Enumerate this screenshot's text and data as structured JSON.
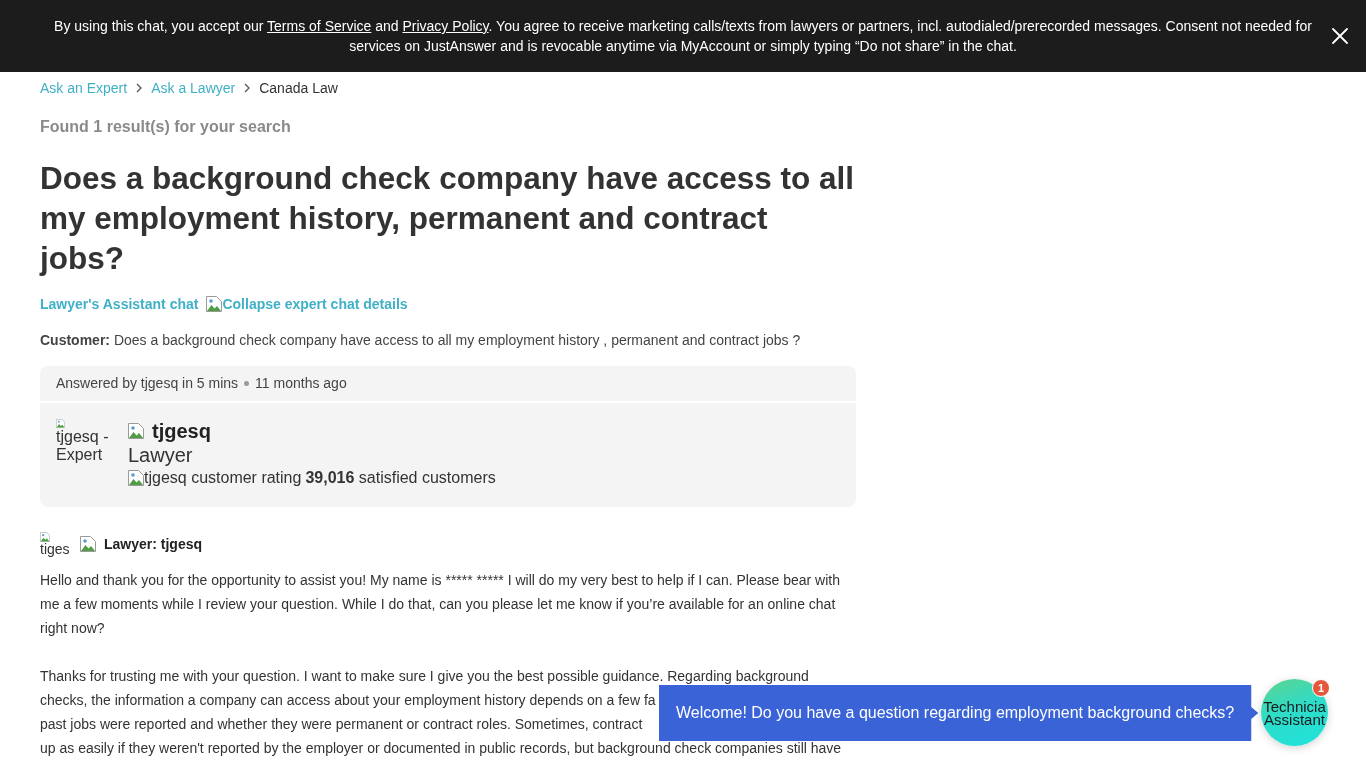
{
  "consent_banner": {
    "segments": [
      {
        "kind": "text",
        "text": "By using this chat, you accept our "
      },
      {
        "kind": "link",
        "text": "Terms of Service"
      },
      {
        "kind": "text",
        "text": " and "
      },
      {
        "kind": "link",
        "text": "Privacy Policy"
      },
      {
        "kind": "text",
        "text": ". You agree to receive marketing calls/texts from lawyers or partners, incl. autodialed/prerecorded messages. Consent not needed for services on JustAnswer and is revocable anytime via MyAccount or simply typing “Do not share” in the chat."
      }
    ]
  },
  "breadcrumb": [
    {
      "kind": "link",
      "text": "Ask an Expert"
    },
    {
      "kind": "link",
      "text": "Ask a Lawyer"
    },
    {
      "kind": "current",
      "text": "Canada Law"
    }
  ],
  "search_summary": "Found 1 result(s) for your search",
  "question_title": "Does a background check company have access to all my employment history, permanent and contract jobs?",
  "chat_links": [
    {
      "kind": "text_link",
      "text": "Lawyer's Assistant chat"
    },
    {
      "kind": "image_link",
      "text": "Collapse expert chat details"
    }
  ],
  "customer_question": "**Customer:** Does a background check company have access to all my employment history , permanent and contract jobs ?",
  "answer_card": {
    "answered_by": "Answered by tjgesq in 5 mins",
    "time_ago": "11 months ago",
    "avatar_alt": "tjgesq - Expert",
    "expert_name": "tjgesq",
    "expert_title": "Lawyer",
    "rating_alt": "tjgesq customer rating",
    "satisfied": "**39,016** satisfied customers"
  },
  "reply": {
    "avatar_alt": "tiges",
    "author": "Lawyer: tjgesq",
    "paragraphs": [
      {
        "kind": "text",
        "text": "Hello and thank you for the opportunity to assist you! My name is ***** ***** I will do my very best to help if I can. Please bear with me a few moments while I review your question. While I do that, can you please let me know if you’re available for an online chat right now?"
      },
      {
        "kind": "lines",
        "lines": [
          "Thanks for trusting me with your question. I want to make sure I give you the best possible guidance. Regarding background",
          "checks, the information a company can access about your employment history depends on a few fa",
          "past jobs were reported and whether they were permanent or contract roles. Sometimes, contract",
          "up as easily if they weren't reported by the employer or documented in public records, but background check companies still have"
        ]
      }
    ]
  },
  "chat_widget": {
    "message": "Welcome! Do you have a question regarding employment background checks?",
    "launcher_lines": [
      "Technicia",
      "Assistant"
    ],
    "badge": "1"
  }
}
